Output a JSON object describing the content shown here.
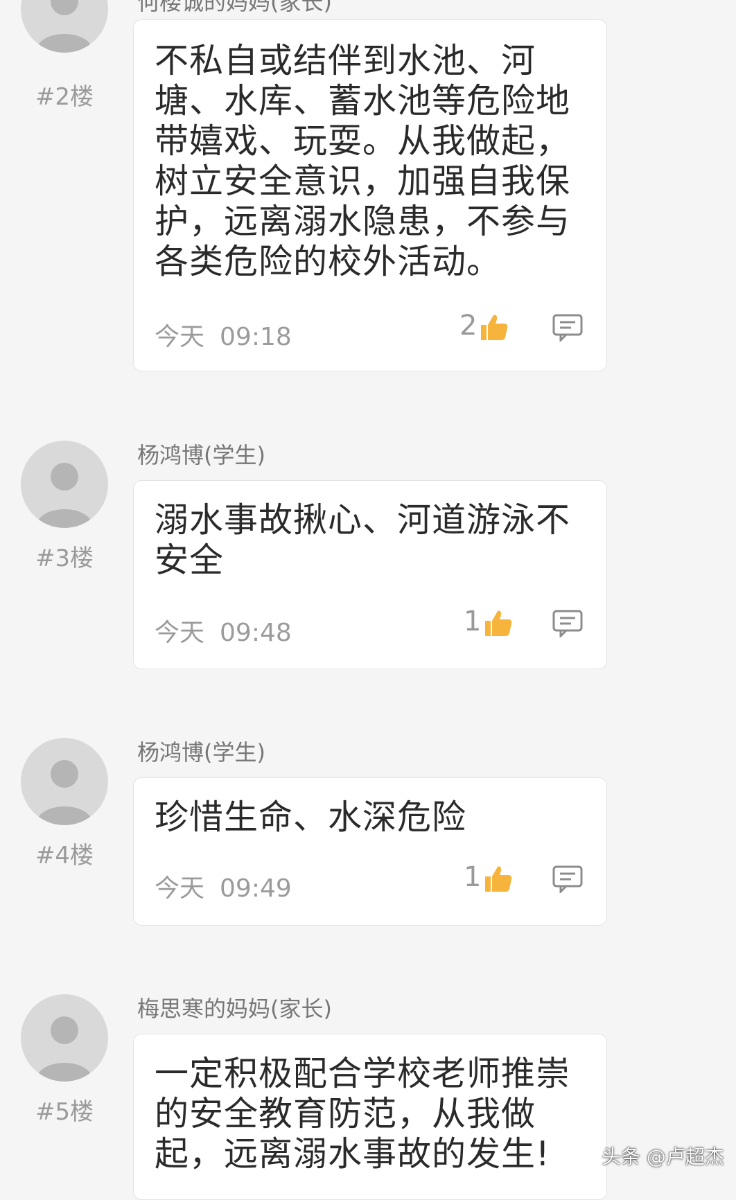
{
  "top_cut_author": "何楼诚的妈妈(家长)",
  "posts": [
    {
      "floor": "#2楼",
      "author": "",
      "content": "不私自或结伴到水池、河塘、水库、蓄水池等危险地带嬉戏、玩耍。从我做起，树立安全意识，加强自我保护，远离溺水隐患，不参与各类危险的校外活动。",
      "date": "今天",
      "time": "09:18",
      "likes": "2"
    },
    {
      "floor": "#3楼",
      "author": "杨鸿博(学生)",
      "content": "溺水事故揪心、河道游泳不安全",
      "date": "今天",
      "time": "09:48",
      "likes": "1"
    },
    {
      "floor": "#4楼",
      "author": "杨鸿博(学生)",
      "content": "珍惜生命、水深危险",
      "date": "今天",
      "time": "09:49",
      "likes": "1"
    },
    {
      "floor": "#5楼",
      "author": "梅思寒的妈妈(家长)",
      "content": "一定积极配合学校老师推崇的安全教育防范，从我做起，远离溺水事故的发生!",
      "date": "",
      "time": "",
      "likes": ""
    }
  ],
  "icons": {
    "avatar": "default-avatar-icon",
    "like": "thumbs-up-icon",
    "reply": "comment-icon"
  },
  "colors": {
    "background": "#f5f5f5",
    "card": "#ffffff",
    "like_icon": "#f7b43c",
    "secondary_text": "#9b9b9b"
  },
  "watermark": "头条 @卢超杰"
}
